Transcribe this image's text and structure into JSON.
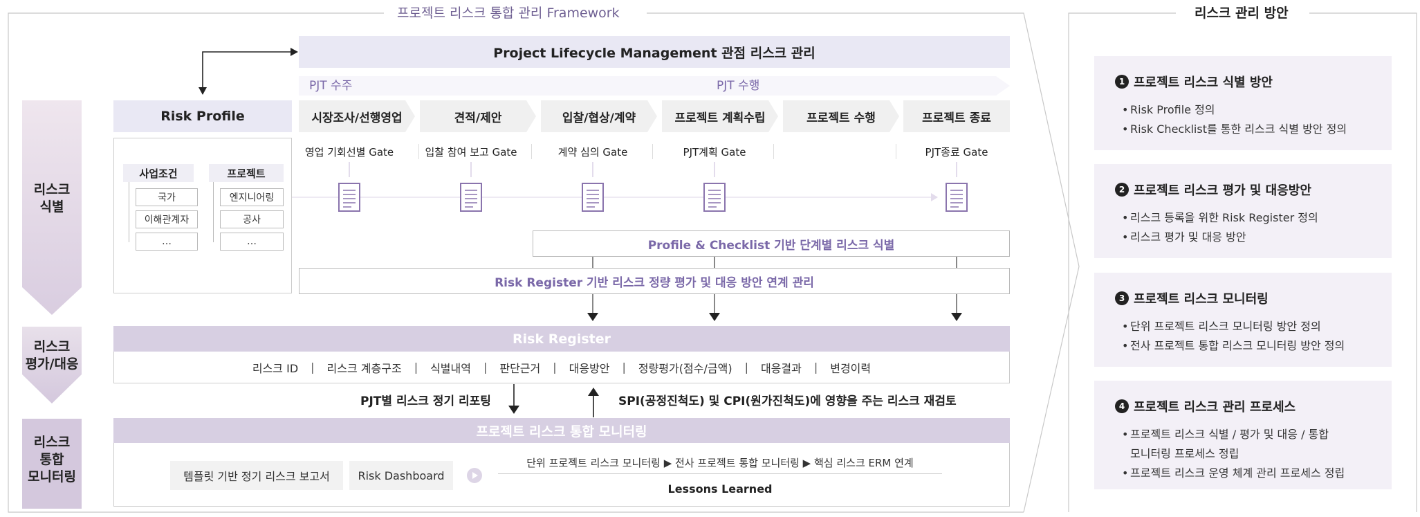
{
  "framework_title": "프로젝트 리스크 통합 관리 Framework",
  "side_title": "리스크 관리 방안",
  "plm_title": "Project Lifecycle Management 관점 리스크 관리",
  "phase_labels": [
    "PJT 수주",
    "PJT 수행"
  ],
  "left_categories": {
    "identify": [
      "리스크",
      "식별"
    ],
    "assess": [
      "리스크",
      "평가/대응"
    ],
    "monitor": [
      "리스크",
      "통합",
      "모니터링"
    ]
  },
  "risk_profile": {
    "title": "Risk Profile",
    "business": {
      "title": "사업조건",
      "items": [
        "국가",
        "이해관계자",
        "…"
      ]
    },
    "project": {
      "title": "프로젝트",
      "items": [
        "엔지니어링",
        "공사",
        "…"
      ]
    }
  },
  "stages": [
    "시장조사/선행영업",
    "견적/제안",
    "입찰/협상/계약",
    "프로젝트 계획수립",
    "프로젝트 수행",
    "프로젝트 종료"
  ],
  "gates": [
    "영업 기회선별 Gate",
    "입찰 참여 보고 Gate",
    "계약 심의 Gate",
    "PJT계획 Gate",
    "",
    "PJT종료 Gate"
  ],
  "doc_icon": "document-icon",
  "profile_checklist": "Profile & Checklist 기반 단계별 리스크 식별",
  "risk_register_link": "Risk Register 기반 리스크 정량 평가 및 대응 방안 연계 관리",
  "risk_register": {
    "title": "Risk Register",
    "fields": [
      "리스크 ID",
      "리스크 계층구조",
      "식별내역",
      "판단근거",
      "대응방안",
      "정량평가(점수/금액)",
      "대응결과",
      "변경이력"
    ]
  },
  "reporting": {
    "left": "PJT별 리스크 정기 리포팅",
    "right": "SPI(공정진척도) 및 CPI(원가진척도)에 영향을 주는 리스크 재검토"
  },
  "monitoring": {
    "title": "프로젝트 리스크 통합 모니터링",
    "report": "템플릿 기반 정기 리스크 보고서",
    "dashboard": "Risk Dashboard",
    "flow": "단위 프로젝트 리스크 모니터링 ▶ 전사 프로젝트 통합 모니터링 ▶ 핵심 리스크 ERM 연계",
    "lessons": "Lessons Learned"
  },
  "cards": [
    {
      "num": "1",
      "title": "프로젝트 리스크 식별 방안",
      "items": [
        "Risk Profile 정의",
        "Risk Checklist를 통한 리스크 식별 방안 정의"
      ]
    },
    {
      "num": "2",
      "title": "프로젝트 리스크 평가 및 대응방안",
      "items": [
        "리스크 등록을 위한 Risk Register 정의",
        "리스크 평가 및 대응 방안"
      ]
    },
    {
      "num": "3",
      "title": "프로젝트 리스크 모니터링",
      "items": [
        "단위 프로젝트 리스크 모니터링 방안 정의",
        "전사 프로젝트 통합 리스크 모니터링 방안 정의"
      ]
    },
    {
      "num": "4",
      "title": "프로젝트 리스크 관리 프로세스",
      "items": [
        "프로젝트 리스크 식별 / 평가 및 대응 / 통합 모니터링 프로세스 정립",
        "프로젝트 리스크 운영 체계 관리 프로세스 정립"
      ]
    }
  ],
  "colors": {
    "accent": "#7a68a8",
    "band": "#d7cfe2",
    "left_grad_top": "#efe6ee",
    "left_grad_bottom": "#d9cde0",
    "card_bg": "#f3f0f7"
  }
}
